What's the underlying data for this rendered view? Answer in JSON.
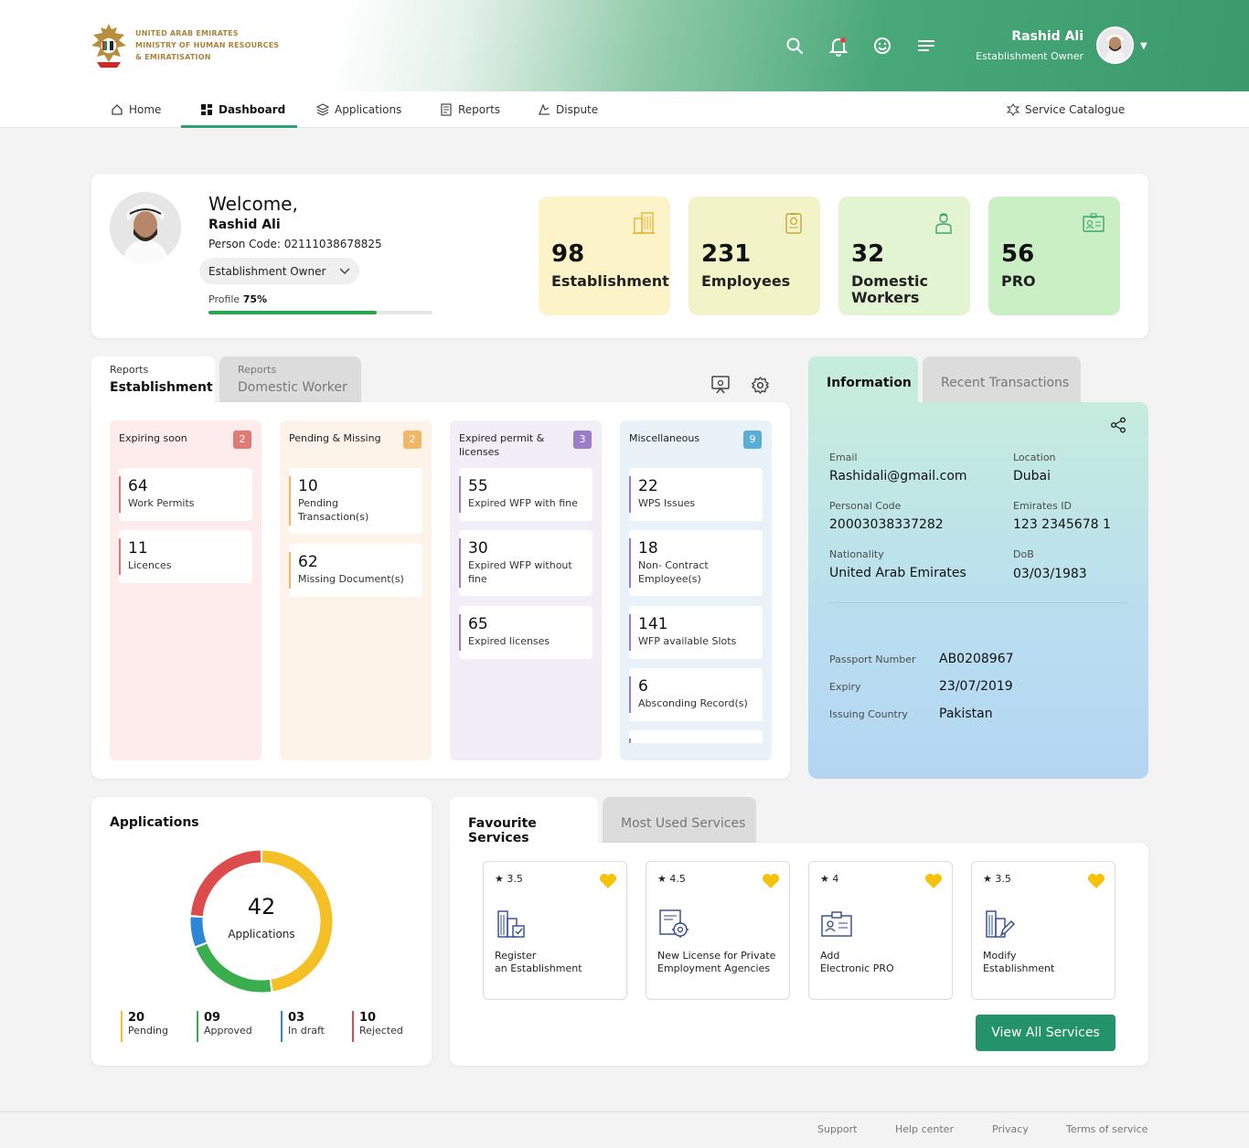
{
  "header": {
    "ministry_lines": [
      "UNITED ARAB EMIRATES",
      "MINISTRY OF HUMAN RESOURCES",
      "& EMIRATISATION"
    ],
    "user_name": "Rashid Ali",
    "user_role": "Establishment Owner",
    "icons": [
      "search-icon",
      "bell-icon",
      "smiley-icon",
      "menu-icon",
      "chevron-down-icon"
    ]
  },
  "nav": {
    "items": [
      {
        "label": "Home",
        "icon": "home-icon"
      },
      {
        "label": "Dashboard",
        "icon": "dashboard-icon",
        "active": true
      },
      {
        "label": "Applications",
        "icon": "layers-icon"
      },
      {
        "label": "Reports",
        "icon": "report-icon"
      },
      {
        "label": "Dispute",
        "icon": "dispute-icon"
      }
    ],
    "service_catalogue": "Service Catalogue"
  },
  "welcome": {
    "greeting": "Welcome,",
    "name": "Rashid Ali",
    "person_code": "Person Code: 02111038678825",
    "role_select": "Establishment Owner",
    "profile_label": "Profile",
    "profile_value": "75%",
    "profile_fraction": 0.75
  },
  "stats": [
    {
      "value": "98",
      "label": "Establishment",
      "bg": "#fdf3c9",
      "icon_color": "#e7b23a"
    },
    {
      "value": "231",
      "label": "Employees",
      "bg": "#f2f4c8",
      "icon_color": "#c7a43f"
    },
    {
      "value": "32",
      "label": "Domestic Workers",
      "bg": "#e2f4d2",
      "icon_color": "#3fa56c"
    },
    {
      "value": "56",
      "label": "PRO",
      "bg": "#cbefc5",
      "icon_color": "#3fa56c"
    }
  ],
  "reports": {
    "tabs": [
      {
        "small": "Reports",
        "big": "Establishment",
        "active": true
      },
      {
        "small": "Reports",
        "big": "Domestic Worker",
        "active": false
      }
    ],
    "columns": [
      {
        "title": "Expiring soon",
        "badge": "2",
        "badge_color": "#e07a74",
        "bg": "#fdeceb",
        "bar_color": "#e07a74",
        "items": [
          {
            "n": "64",
            "t": "Work Permits"
          },
          {
            "n": "11",
            "t": "Licences"
          }
        ]
      },
      {
        "title": "Pending & Missing",
        "badge": "2",
        "badge_color": "#f2b766",
        "bg": "#fef3e8",
        "bar_color": "#f2b766",
        "items": [
          {
            "n": "10",
            "t": "Pending Transaction(s)"
          },
          {
            "n": "62",
            "t": "Missing Document(s)"
          }
        ]
      },
      {
        "title": "Expired permit & licenses",
        "badge": "3",
        "badge_color": "#9a7cc9",
        "bg": "#f1eef8",
        "bar_color": "#9a7cc9",
        "items": [
          {
            "n": "55",
            "t": "Expired WFP with fine"
          },
          {
            "n": "30",
            "t": "Expired WFP without fine"
          },
          {
            "n": "65",
            "t": "Expired licenses"
          }
        ]
      },
      {
        "title": "Miscellaneous",
        "badge": "9",
        "badge_color": "#5aaed6",
        "bg": "#e8f2f8",
        "bar_color": "#9a7cc9",
        "items": [
          {
            "n": "22",
            "t": "WPS Issues"
          },
          {
            "n": "18",
            "t": "Non- Contract Employee(s)"
          },
          {
            "n": "141",
            "t": "WFP available Slots"
          },
          {
            "n": "6",
            "t": "Absconding Record(s)"
          }
        ]
      }
    ]
  },
  "info": {
    "tabs": [
      "Information",
      "Recent Transactions"
    ],
    "fields": [
      {
        "label": "Email",
        "value": "Rashidali@gmail.com"
      },
      {
        "label": "Location",
        "value": "Dubai"
      },
      {
        "label": "Personal Code",
        "value": "20003038337282"
      },
      {
        "label": "Emirates ID",
        "value": "123 2345678 1"
      },
      {
        "label": "Nationality",
        "value": "United Arab Emirates"
      },
      {
        "label": "DoB",
        "value": "03/03/1983"
      }
    ],
    "passport": [
      {
        "label": "Passport Number",
        "value": "AB0208967"
      },
      {
        "label": "Expiry",
        "value": "23/07/2019"
      },
      {
        "label": "Issuing Country",
        "value": "Pakistan"
      }
    ]
  },
  "applications": {
    "title": "Applications",
    "total": "42",
    "total_label": "Applications",
    "legend": [
      {
        "value": "20",
        "label": "Pending",
        "color": "#f5c026"
      },
      {
        "value": "09",
        "label": "Approved",
        "color": "#3aae4f"
      },
      {
        "value": "03",
        "label": "In draft",
        "color": "#2f86d6"
      },
      {
        "value": "10",
        "label": "Rejected",
        "color": "#dc4c4c"
      }
    ]
  },
  "chart_data": {
    "type": "pie",
    "categories": [
      "Pending",
      "Approved",
      "In draft",
      "Rejected"
    ],
    "values": [
      20,
      9,
      3,
      10
    ],
    "colors": [
      "#f5c026",
      "#3aae4f",
      "#2f86d6",
      "#dc4c4c"
    ]
  },
  "services": {
    "tabs": [
      "Favourite Services",
      "Most Used Services"
    ],
    "items": [
      {
        "rating": "3.5",
        "line1": "Register",
        "line2": "an Establishment",
        "icon": "building-check-icon"
      },
      {
        "rating": "4.5",
        "line1": "New License for Private",
        "line2": "Employment Agencies",
        "icon": "license-gear-icon"
      },
      {
        "rating": "4",
        "line1": "Add",
        "line2": "Electronic PRO",
        "icon": "id-card-icon"
      },
      {
        "rating": "3.5",
        "line1": "Modify",
        "line2": "Establishment",
        "icon": "building-edit-icon"
      }
    ],
    "view_all": "View All Services"
  },
  "footer": {
    "links": [
      "Support",
      "Help center",
      "Privacy",
      "Terms of service"
    ]
  }
}
